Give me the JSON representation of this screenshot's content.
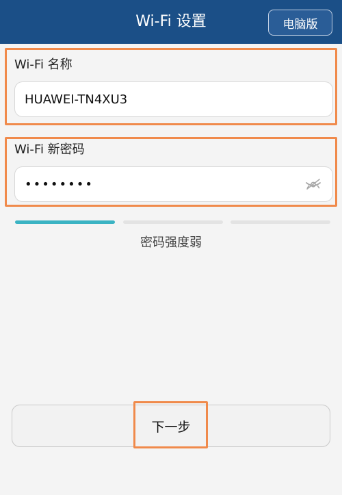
{
  "header": {
    "title": "Wi-Fi 设置",
    "desktop_button_label": "电脑版",
    "background_color": "#1b4f87"
  },
  "form": {
    "ssid": {
      "label": "Wi-Fi 名称",
      "value": "HUAWEI-TN4XU3"
    },
    "password": {
      "label": "Wi-Fi 新密码",
      "value": "••••••••",
      "visibility_icon": "eye-off-icon"
    }
  },
  "strength": {
    "levels_total": 3,
    "level": 1,
    "active_color": "#3bb3c3",
    "inactive_color": "#e3e3e3",
    "text": "密码强度弱"
  },
  "next_button_label": "下一步",
  "highlight_color": "#f08a4b"
}
